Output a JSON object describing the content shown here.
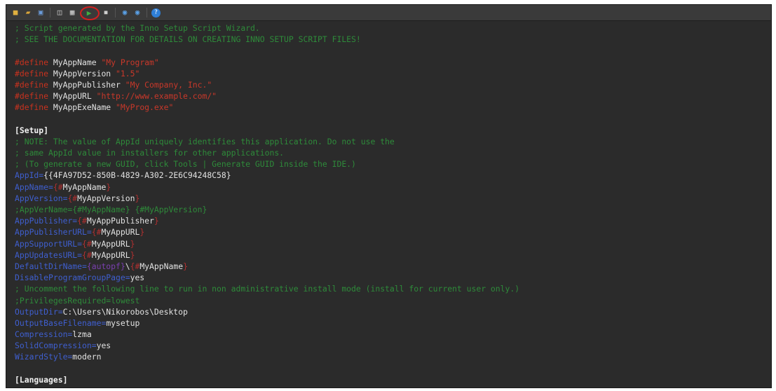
{
  "toolbar": {
    "icons": [
      "new-icon",
      "open-icon",
      "save-icon",
      "print-icon",
      "compile-icon",
      "run-icon",
      "stop-icon",
      "globe-icon",
      "globe-icon-2",
      "help-icon"
    ]
  },
  "script": {
    "header_comments": [
      "; Script generated by the Inno Setup Script Wizard.",
      "; SEE THE DOCUMENTATION FOR DETAILS ON CREATING INNO SETUP SCRIPT FILES!"
    ],
    "defines": [
      {
        "kw": "#define",
        "name": " MyAppName ",
        "value": "\"My Program\""
      },
      {
        "kw": "#define",
        "name": " MyAppVersion ",
        "value": "\"1.5\""
      },
      {
        "kw": "#define",
        "name": " MyAppPublisher ",
        "value": "\"My Company, Inc.\""
      },
      {
        "kw": "#define",
        "name": " MyAppURL ",
        "value": "\"http://www.example.com/\""
      },
      {
        "kw": "#define",
        "name": " MyAppExeName ",
        "value": "\"MyProg.exe\""
      }
    ],
    "setup_section": "[Setup]",
    "setup_comments": [
      "; NOTE: The value of AppId uniquely identifies this application. Do not use the",
      "; same AppId value in installers for other applications.",
      "; (To generate a new GUID, click Tools | Generate GUID inside the IDE.)"
    ],
    "appid_key": "AppId=",
    "appid_value": "{{4FA97D52-850B-4829-A302-2E6C94248C58}",
    "lines": [
      {
        "key": "AppName=",
        "pre": "{#",
        "val": "MyAppName",
        "post": "}"
      },
      {
        "key": "AppVersion=",
        "pre": "{#",
        "val": "MyAppVersion",
        "post": "}"
      },
      {
        "comment": ";AppVerName={#MyAppName} {#MyAppVersion}"
      },
      {
        "key": "AppPublisher=",
        "pre": "{#",
        "val": "MyAppPublisher",
        "post": "}"
      },
      {
        "key": "AppPublisherURL=",
        "pre": "{#",
        "val": "MyAppURL",
        "post": "}"
      },
      {
        "key": "AppSupportURL=",
        "pre": "{#",
        "val": "MyAppURL",
        "post": "}"
      },
      {
        "key": "AppUpdatesURL=",
        "pre": "{#",
        "val": "MyAppURL",
        "post": "}"
      },
      {
        "key": "DefaultDirName=",
        "const": "{autopf}",
        "mid": "\\",
        "pre": "{#",
        "val": "MyAppName",
        "post": "}"
      },
      {
        "key": "DisableProgramGroupPage=",
        "val": "yes"
      },
      {
        "comment": "; Uncomment the following line to run in non administrative install mode (install for current user only.)"
      },
      {
        "comment": ";PrivilegesRequired=lowest"
      },
      {
        "key": "OutputDir=",
        "val": "C:\\Users\\Nikorobos\\Desktop"
      },
      {
        "key": "OutputBaseFilename=",
        "val": "mysetup"
      },
      {
        "key": "Compression=",
        "val": "lzma"
      },
      {
        "key": "SolidCompression=",
        "val": "yes"
      },
      {
        "key": "WizardStyle=",
        "val": "modern"
      }
    ],
    "languages_section": "[Languages]"
  },
  "colors": {
    "background": "#2b2b2b",
    "comment": "#2e8b3a",
    "define": "#c8321f",
    "key": "#3f5fd0",
    "run_highlight": "#d22020"
  }
}
